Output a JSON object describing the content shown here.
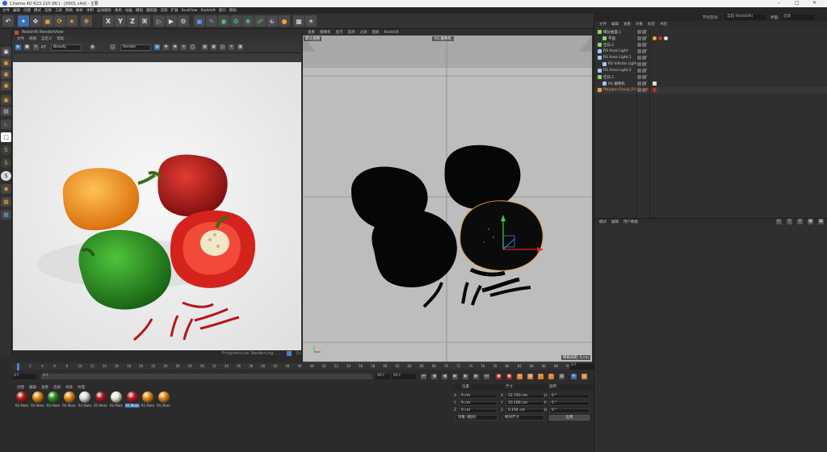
{
  "app": {
    "title": "Cinema 4D R23.110 (RC) - [0001.c4d] - 主要"
  },
  "menubar": [
    "文件",
    "编辑",
    "创建",
    "模式",
    "选择",
    "工具",
    "网格",
    "样条",
    "体积",
    "运动图形",
    "角色",
    "动画",
    "模拟",
    "跟踪器",
    "渲染",
    "扩展",
    "RealFlow",
    "Redshift",
    "窗口",
    "帮助"
  ],
  "objmgr_top": {
    "layout_label": "节点空间:",
    "layout_value": "当前 (Redshift)",
    "interface_label": "界面:",
    "interface_value": "启动"
  },
  "renderview": {
    "title": "Redshift RenderView",
    "menus": [
      "文件",
      "视图",
      "自定义",
      "帮助"
    ],
    "beauty": "Beauty",
    "camera": "Render",
    "status": "Progressive Rendering...",
    "zoom": "1%"
  },
  "viewport": {
    "menus": [
      "查看",
      "摄像机",
      "显示",
      "选项",
      "过滤",
      "面板",
      "Redshift"
    ],
    "cam_label": "默认视图",
    "tag": "RS 摄像机",
    "grid": "网格间距: 5 cm"
  },
  "timeline": {
    "ticks": [
      "0",
      "2",
      "4",
      "6",
      "8",
      "10",
      "12",
      "14",
      "16",
      "18",
      "20",
      "22",
      "24",
      "26",
      "28",
      "30",
      "32",
      "34",
      "36",
      "38",
      "40",
      "42",
      "44",
      "46",
      "48",
      "50",
      "52",
      "54",
      "56",
      "58",
      "60",
      "62",
      "64",
      "66",
      "68",
      "70",
      "72",
      "74",
      "76",
      "78",
      "80",
      "82",
      "84",
      "86",
      "88",
      "90"
    ],
    "current": "0 F",
    "start": "0 F",
    "min": "0 F",
    "max": "90 F",
    "end": "90 F",
    "frame_display": "0 F"
  },
  "materials": {
    "menus": [
      "创建",
      "编辑",
      "查看",
      "选择",
      "材质",
      "纹理"
    ],
    "items": [
      {
        "label": "RS Mate",
        "color": "#b31b16"
      },
      {
        "label": "RS Mate",
        "color": "#e58a12"
      },
      {
        "label": "RS Mate",
        "color": "#2f8f24"
      },
      {
        "label": "RS Mate",
        "color": "#e58a12"
      },
      {
        "label": "RS Mate",
        "color": "#dddddd"
      },
      {
        "label": "RS Mate",
        "color": "#a8161a"
      },
      {
        "label": "RS Mate",
        "color": "#ece6d6"
      },
      {
        "label": "RS Mate",
        "color": "#c3161b"
      },
      {
        "label": "RS Mate",
        "color": "#e58a12"
      },
      {
        "label": "RS Mate",
        "color": "#e58a12"
      }
    ]
  },
  "coords": {
    "headers": [
      "位置",
      "尺寸",
      "旋转"
    ],
    "rows": [
      {
        "axis": "X",
        "pos": "0 cm",
        "size_axis": "X",
        "size": "12.743 cm",
        "rot_axis": "H",
        "rot": "0 °"
      },
      {
        "axis": "Y",
        "pos": "0 cm",
        "size_axis": "Y",
        "size": "10.166 cm",
        "rot_axis": "P",
        "rot": "0 °"
      },
      {
        "axis": "Z",
        "pos": "0 cm",
        "size_axis": "Z",
        "size": "0.194 cm",
        "rot_axis": "B",
        "rot": "0 °"
      }
    ],
    "mode1": "对象 (相对)",
    "mode2": "绝对尺寸",
    "apply": "应用"
  },
  "objmgr": {
    "menus": [
      "文件",
      "编辑",
      "查看",
      "对象",
      "标签",
      "书签"
    ],
    "objects": [
      {
        "name": "细分曲面.1",
        "indent": 0,
        "color": "#8fd26a"
      },
      {
        "name": "平面",
        "indent": 1,
        "color": "#8fd26a"
      },
      {
        "name": "空白.2",
        "indent": 0,
        "color": "#8fd26a"
      },
      {
        "name": "RS Area Light",
        "indent": 0,
        "color": "#9ec8ff"
      },
      {
        "name": "RS Area Light.1",
        "indent": 0,
        "color": "#9ec8ff"
      },
      {
        "name": "RS Infinite Light",
        "indent": 1,
        "color": "#9ec8ff"
      },
      {
        "name": "RS Area Light.2",
        "indent": 0,
        "color": "#9ec8ff"
      },
      {
        "name": "空白.1",
        "indent": 0,
        "color": "#8fd26a"
      },
      {
        "name": "RS 摄像机",
        "indent": 1,
        "color": "#9ec8ff"
      },
      {
        "name": "Polygon Group_0-80",
        "indent": 0,
        "color": "#e8a04a"
      }
    ]
  },
  "attrmgr": {
    "menus": [
      "模式",
      "编辑",
      "用户数据"
    ]
  }
}
